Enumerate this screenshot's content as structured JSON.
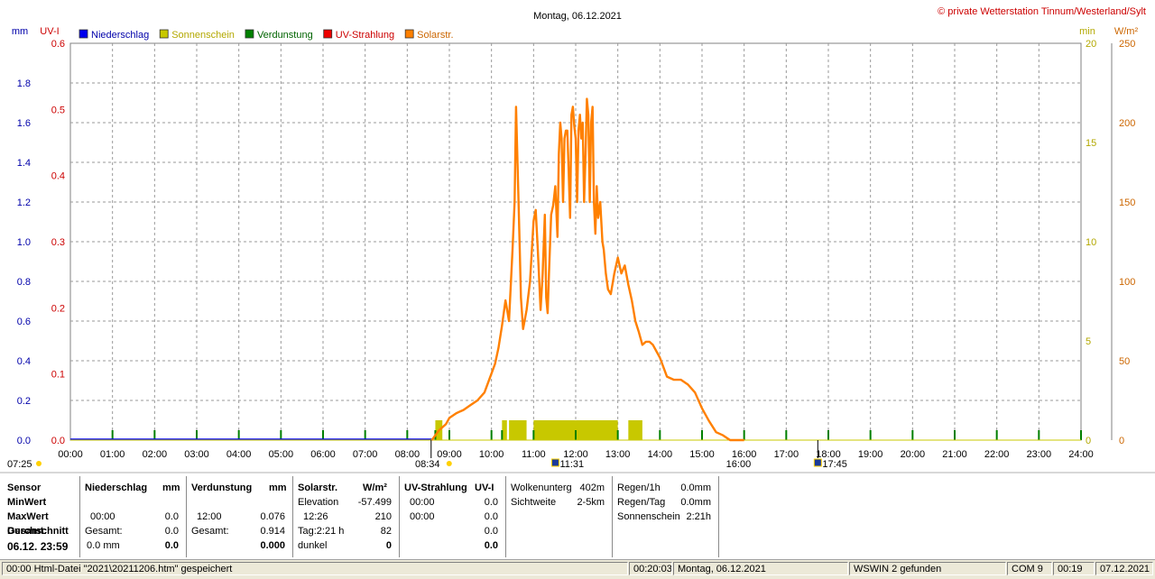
{
  "chart_data": {
    "type": "line",
    "title": "Montag, 06.12.2021",
    "copyright": "© private Wetterstation Tinnum/Westerland/Sylt",
    "x_axis": {
      "range": [
        "00:00",
        "24:00"
      ],
      "ticks": [
        "00:00",
        "01:00",
        "02:00",
        "03:00",
        "04:00",
        "05:00",
        "06:00",
        "07:00",
        "08:00",
        "09:00",
        "10:00",
        "11:00",
        "12:00",
        "13:00",
        "14:00",
        "15:00",
        "16:00",
        "17:00",
        "18:00",
        "19:00",
        "20:00",
        "21:00",
        "22:00",
        "23:00",
        "24:00"
      ]
    },
    "left_axes": [
      {
        "unit": "mm",
        "color": "#0000aa",
        "ylim": [
          0,
          2.0
        ],
        "ticks": [
          "0.0",
          "0.2",
          "0.4",
          "0.6",
          "0.8",
          "1.0",
          "1.2",
          "1.4",
          "1.6",
          "1.8"
        ]
      },
      {
        "unit": "UV-I",
        "color": "#cc0000",
        "ylim": [
          0,
          0.6
        ],
        "ticks": [
          "0.0",
          "0.1",
          "0.2",
          "0.3",
          "0.4",
          "0.5",
          "0.6"
        ]
      }
    ],
    "right_axes": [
      {
        "unit": "min",
        "color": "#b3a800",
        "ylim": [
          0,
          20
        ],
        "ticks": [
          "0",
          "5",
          "10",
          "15",
          "20"
        ]
      },
      {
        "unit": "W/m²",
        "color": "#cc6600",
        "ylim": [
          0,
          250
        ],
        "ticks": [
          "0",
          "50",
          "100",
          "150",
          "200",
          "250"
        ]
      }
    ],
    "legend": [
      {
        "name": "Niederschlag",
        "color": "#0000ee",
        "text_color": "#0000aa"
      },
      {
        "name": "Sonnenschein",
        "color": "#c8c800",
        "text_color": "#b3a800"
      },
      {
        "name": "Verdunstung",
        "color": "#008000",
        "text_color": "#006400"
      },
      {
        "name": "UV-Strahlung",
        "color": "#ee0000",
        "text_color": "#cc0000"
      },
      {
        "name": "Solarstr.",
        "color": "#ff8000",
        "text_color": "#cc6600"
      }
    ],
    "grid": true,
    "legend_placement": "top-left",
    "series": [
      {
        "name": "Solarstr.",
        "axis": "W/m²",
        "color": "#ff8000",
        "x": [
          "08:35",
          "08:40",
          "08:45",
          "08:55",
          "09:00",
          "09:10",
          "09:20",
          "09:30",
          "09:40",
          "09:50",
          "10:00",
          "10:05",
          "10:10",
          "10:15",
          "10:20",
          "10:25",
          "10:30",
          "10:33",
          "10:35",
          "10:38",
          "10:40",
          "10:42",
          "10:45",
          "10:50",
          "10:55",
          "11:00",
          "11:03",
          "11:06",
          "11:10",
          "11:13",
          "11:16",
          "11:18",
          "11:20",
          "11:22",
          "11:25",
          "11:28",
          "11:31",
          "11:34",
          "11:36",
          "11:38",
          "11:40",
          "11:42",
          "11:44",
          "11:46",
          "11:48",
          "11:50",
          "11:52",
          "11:54",
          "11:56",
          "11:58",
          "12:00",
          "12:02",
          "12:04",
          "12:06",
          "12:08",
          "12:10",
          "12:12",
          "12:14",
          "12:16",
          "12:18",
          "12:20",
          "12:22",
          "12:24",
          "12:26",
          "12:28",
          "12:30",
          "12:32",
          "12:35",
          "12:38",
          "12:40",
          "12:43",
          "12:46",
          "12:50",
          "12:55",
          "13:00",
          "13:05",
          "13:10",
          "13:15",
          "13:20",
          "13:25",
          "13:30",
          "13:35",
          "13:40",
          "13:45",
          "13:50",
          "14:00",
          "14:10",
          "14:20",
          "14:30",
          "14:40",
          "14:50",
          "15:00",
          "15:10",
          "15:20",
          "15:30",
          "15:40",
          "15:50",
          "16:00"
        ],
        "y": [
          0,
          3,
          6,
          10,
          14,
          17,
          19,
          22,
          25,
          30,
          42,
          48,
          58,
          72,
          88,
          75,
          120,
          150,
          210,
          160,
          125,
          90,
          70,
          82,
          100,
          138,
          145,
          120,
          82,
          105,
          142,
          90,
          80,
          105,
          142,
          148,
          160,
          128,
          180,
          200,
          190,
          150,
          190,
          195,
          195,
          170,
          140,
          205,
          210,
          198,
          190,
          150,
          195,
          205,
          190,
          200,
          150,
          180,
          215,
          205,
          150,
          200,
          210,
          150,
          130,
          160,
          140,
          150,
          125,
          120,
          105,
          95,
          92,
          105,
          115,
          105,
          110,
          98,
          88,
          75,
          68,
          60,
          62,
          62,
          60,
          52,
          40,
          38,
          38,
          35,
          30,
          20,
          12,
          5,
          3,
          0,
          0,
          0
        ]
      },
      {
        "name": "Sonnenschein",
        "axis": "min",
        "color": "#c8c800",
        "intervals": [
          [
            "08:40",
            "08:50"
          ],
          [
            "10:15",
            "10:22"
          ],
          [
            "10:25",
            "10:50"
          ],
          [
            "11:00",
            "13:00"
          ],
          [
            "13:15",
            "13:35"
          ]
        ],
        "value": 1
      },
      {
        "name": "Verdunstung",
        "axis": "mm",
        "color": "#008000",
        "marks_at": [
          "01:00",
          "02:00",
          "03:00",
          "04:00",
          "05:00",
          "06:00",
          "07:00",
          "08:00",
          "08:40",
          "09:00",
          "10:00",
          "10:15",
          "11:00",
          "12:00",
          "13:00",
          "14:00",
          "15:00",
          "16:00",
          "17:00",
          "18:00",
          "19:00",
          "20:00",
          "21:00",
          "22:00",
          "23:00",
          "24:00"
        ]
      },
      {
        "name": "Niederschlag",
        "axis": "mm",
        "color": "#0000ee",
        "values": [
          0
        ]
      },
      {
        "name": "UV-Strahlung",
        "axis": "UV-I",
        "color": "#ee0000",
        "values": [
          0
        ]
      }
    ],
    "sun_markers": {
      "sunrise": "08:34",
      "sunset": "16:00",
      "start": "07:25",
      "noon": "11:31",
      "twilight_end": "17:45"
    }
  },
  "panel": {
    "sensor": {
      "header": "Sensor",
      "rows": [
        "MinWert",
        "MaxWert",
        "Gesamt:",
        "Durchschnitt"
      ],
      "date": "06.12.  23:59"
    },
    "niederschlag": {
      "header": "Niederschlag",
      "unit": "mm",
      "max_time": "00:00",
      "max_val": "0.0",
      "gesamt_label": "Gesamt:",
      "gesamt_val": "0.0",
      "avg_left": "0.0 mm",
      "avg_val": "0.0"
    },
    "verdunstung": {
      "header": "Verdunstung",
      "unit": "mm",
      "max_time": "12:00",
      "max_val": "0.076",
      "gesamt_label": "Gesamt:",
      "gesamt_val": "0.914",
      "avg_val": "0.000"
    },
    "solar": {
      "header": "Solarstr.",
      "unit": "W/m²",
      "elev_label": "Elevation",
      "elev_val": "-57.499",
      "max_time": "12:26",
      "max_val": "210",
      "tag_label": "Tag:2:21 h",
      "tag_val": "82",
      "dunkel_label": "dunkel",
      "dunkel_val": "0"
    },
    "uv": {
      "header": "UV-Strahlung",
      "unit": "UV-I",
      "min_time": "00:00",
      "min_val": "0.0",
      "max_time": "00:00",
      "max_val": "0.0",
      "gesamt_val": "0.0",
      "avg_val": "0.0"
    },
    "wolken": {
      "label1": "Wolkenunterg",
      "val1": "402m",
      "label2": "Sichtweite",
      "val2": "2-5km"
    },
    "regen": {
      "label1": "Regen/1h",
      "val1": "0.0mm",
      "label2": "Regen/Tag",
      "val2": "0.0mm",
      "label3": "Sonnenschein",
      "val3": "2:21h"
    }
  },
  "statusbar": {
    "msg": "00:00  Html-Datei  \"2021\\20211206.htm\"  gespeichert",
    "time": "00:20:03",
    "date_long": "Montag, 06.12.2021",
    "wswin": "WSWIN 2 gefunden",
    "com": "COM 9",
    "clock": "00:19",
    "date": "07.12.2021"
  }
}
